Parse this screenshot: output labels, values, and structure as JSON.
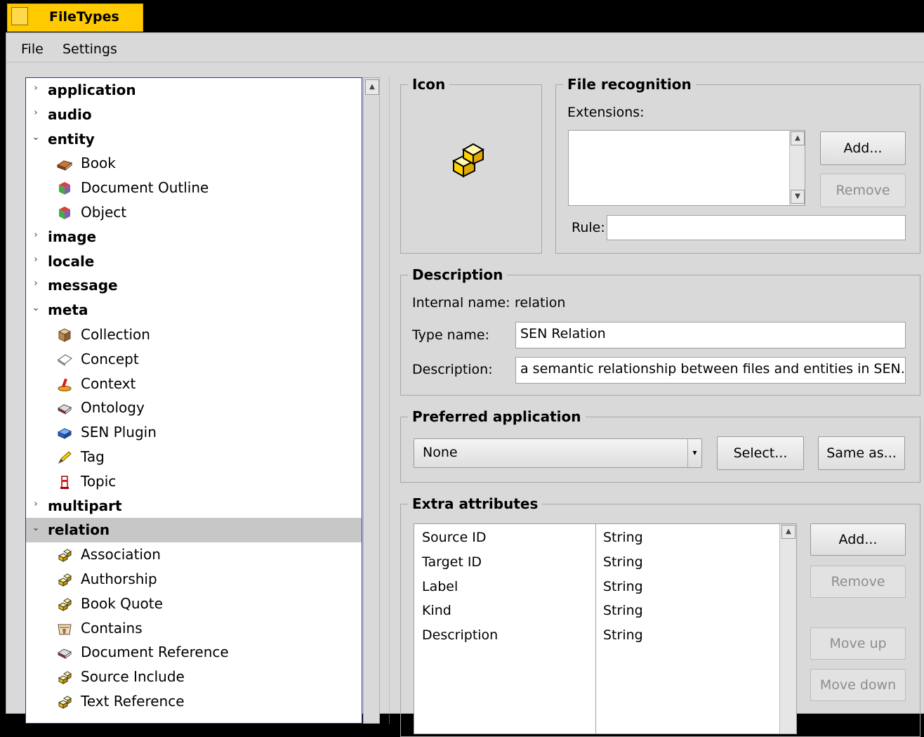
{
  "window": {
    "title": "FileTypes"
  },
  "menubar": {
    "file": "File",
    "settings": "Settings"
  },
  "tree": {
    "rows": [
      {
        "kind": "cat",
        "label": "application",
        "expanded": false
      },
      {
        "kind": "cat",
        "label": "audio",
        "expanded": false
      },
      {
        "kind": "cat",
        "label": "entity",
        "expanded": true
      },
      {
        "kind": "item",
        "label": "Book",
        "icon": "book-icon"
      },
      {
        "kind": "item",
        "label": "Document Outline",
        "icon": "cube-icon"
      },
      {
        "kind": "item",
        "label": "Object",
        "icon": "cube-icon"
      },
      {
        "kind": "cat",
        "label": "image",
        "expanded": false
      },
      {
        "kind": "cat",
        "label": "locale",
        "expanded": false
      },
      {
        "kind": "cat",
        "label": "message",
        "expanded": false
      },
      {
        "kind": "cat",
        "label": "meta",
        "expanded": true
      },
      {
        "kind": "item",
        "label": "Collection",
        "icon": "box-icon"
      },
      {
        "kind": "item",
        "label": "Concept",
        "icon": "concept-icon"
      },
      {
        "kind": "item",
        "label": "Context",
        "icon": "context-icon"
      },
      {
        "kind": "item",
        "label": "Ontology",
        "icon": "ontology-icon"
      },
      {
        "kind": "item",
        "label": "SEN Plugin",
        "icon": "plugin-icon"
      },
      {
        "kind": "item",
        "label": "Tag",
        "icon": "tag-icon"
      },
      {
        "kind": "item",
        "label": "Topic",
        "icon": "topic-icon"
      },
      {
        "kind": "cat",
        "label": "multipart",
        "expanded": false
      },
      {
        "kind": "cat",
        "label": "relation",
        "expanded": true,
        "selected": true
      },
      {
        "kind": "item",
        "label": "Association",
        "icon": "relation-icon"
      },
      {
        "kind": "item",
        "label": "Authorship",
        "icon": "relation-icon"
      },
      {
        "kind": "item",
        "label": "Book Quote",
        "icon": "relation-icon"
      },
      {
        "kind": "item",
        "label": "Contains",
        "icon": "contains-icon"
      },
      {
        "kind": "item",
        "label": "Document Reference",
        "icon": "ontology-icon"
      },
      {
        "kind": "item",
        "label": "Source Include",
        "icon": "relation-icon"
      },
      {
        "kind": "item",
        "label": "Text Reference",
        "icon": "relation-icon"
      }
    ]
  },
  "icon_group": {
    "title": "Icon",
    "icon": "relation-large-icon"
  },
  "recognition": {
    "title": "File recognition",
    "extensions_label": "Extensions:",
    "add": "Add...",
    "remove": "Remove",
    "rule_label": "Rule:",
    "rule_value": ""
  },
  "description": {
    "title": "Description",
    "internal_label": "Internal name:",
    "internal_value": "relation",
    "type_label": "Type name:",
    "type_value": "SEN Relation",
    "desc_label": "Description:",
    "desc_value": "a semantic relationship between files and entities in SEN."
  },
  "preferred": {
    "title": "Preferred application",
    "selected": "None",
    "select": "Select...",
    "same_as": "Same as..."
  },
  "extra": {
    "title": "Extra attributes",
    "rows": [
      {
        "name": "Source ID",
        "type": "String"
      },
      {
        "name": "Target ID",
        "type": "String"
      },
      {
        "name": "Label",
        "type": "String"
      },
      {
        "name": "Kind",
        "type": "String"
      },
      {
        "name": "Description",
        "type": "String"
      }
    ],
    "add": "Add...",
    "remove": "Remove",
    "move_up": "Move up",
    "move_down": "Move down"
  },
  "colors": {
    "tab": "#ffcb00",
    "panel": "#d9d9d9",
    "tree_border": "#2233aa",
    "selected_row": "#c7c7c7"
  }
}
